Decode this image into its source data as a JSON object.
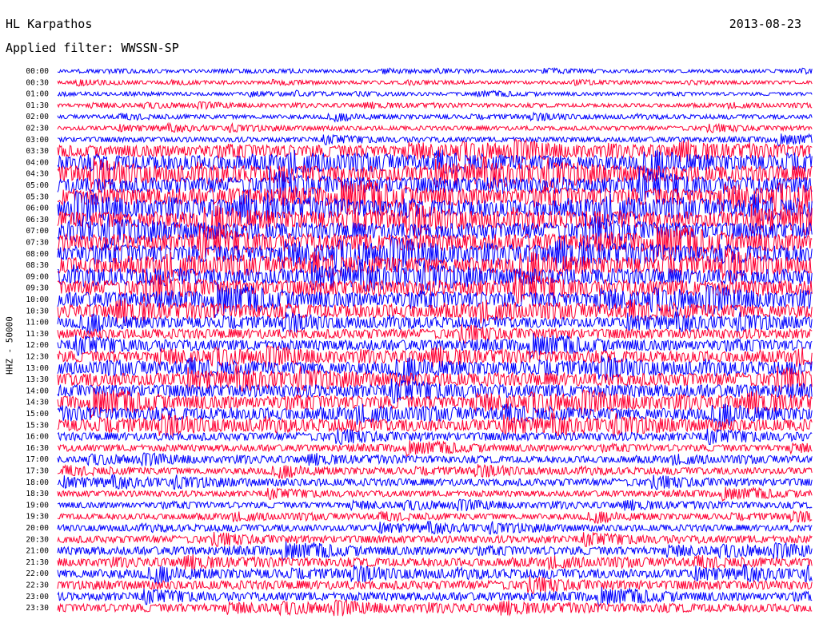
{
  "header": {
    "station": "HL Karpathos",
    "date": "2013-08-23",
    "filter": "Applied filter: WWSSN-SP"
  },
  "chart_data": {
    "type": "line",
    "title": "HL Karpathos",
    "subtitle": "Applied filter: WWSSN-SP",
    "ylabel": "HHZ - 50000",
    "xlabel": "",
    "trace_colors": [
      "#0000ff",
      "#ff0033"
    ],
    "grid": false,
    "row_labels": [
      "00:00",
      "00:30",
      "01:00",
      "01:30",
      "02:00",
      "02:30",
      "03:00",
      "03:30",
      "04:00",
      "04:30",
      "05:00",
      "05:30",
      "06:00",
      "06:30",
      "07:00",
      "07:30",
      "08:00",
      "08:30",
      "09:00",
      "09:30",
      "10:00",
      "10:30",
      "11:00",
      "11:30",
      "12:00",
      "12:30",
      "13:00",
      "13:30",
      "14:00",
      "14:30",
      "15:00",
      "15:30",
      "16:00",
      "16:30",
      "17:00",
      "17:30",
      "18:00",
      "18:30",
      "19:00",
      "19:30",
      "20:00",
      "20:30",
      "21:00",
      "21:30",
      "22:00",
      "22:30",
      "23:00",
      "23:30"
    ],
    "noise_level": [
      0.2,
      0.22,
      0.22,
      0.25,
      0.28,
      0.3,
      0.35,
      0.8,
      1.0,
      1.1,
      1.1,
      1.15,
      1.15,
      1.15,
      1.15,
      1.15,
      1.15,
      1.1,
      1.1,
      1.05,
      1.0,
      0.9,
      0.7,
      0.65,
      0.7,
      0.75,
      0.85,
      0.9,
      0.85,
      0.85,
      0.8,
      0.8,
      0.55,
      0.45,
      0.45,
      0.45,
      0.5,
      0.4,
      0.4,
      0.4,
      0.45,
      0.5,
      0.55,
      0.55,
      0.6,
      0.6,
      0.55,
      0.55
    ]
  }
}
